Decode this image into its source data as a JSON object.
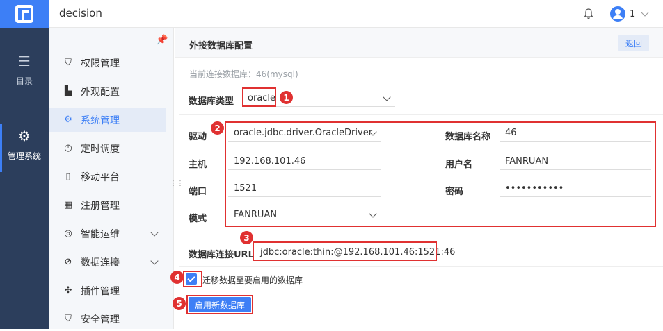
{
  "header": {
    "app_title": "decision",
    "user_name": "1"
  },
  "left_nav": [
    {
      "label": "目录",
      "icon": "list-icon"
    },
    {
      "label": "管理系统",
      "icon": "gear-icon"
    }
  ],
  "sidebar": {
    "items": [
      {
        "label": "权限管理",
        "icon": "shield-icon",
        "expandable": false
      },
      {
        "label": "外观配置",
        "icon": "paint-roller-icon",
        "expandable": false
      },
      {
        "label": "系统管理",
        "icon": "gear-icon",
        "expandable": false,
        "active": true
      },
      {
        "label": "定时调度",
        "icon": "timer-icon",
        "expandable": false
      },
      {
        "label": "移动平台",
        "icon": "mobile-icon",
        "expandable": false
      },
      {
        "label": "注册管理",
        "icon": "register-icon",
        "expandable": false
      },
      {
        "label": "智能运维",
        "icon": "ops-icon",
        "expandable": true
      },
      {
        "label": "数据连接",
        "icon": "link-icon",
        "expandable": true
      },
      {
        "label": "插件管理",
        "icon": "puzzle-icon",
        "expandable": false
      },
      {
        "label": "安全管理",
        "icon": "security-icon",
        "expandable": false
      }
    ]
  },
  "panel": {
    "title": "外接数据库配置",
    "back_label": "返回",
    "current_db_text": "当前连接数据库：46(mysql)",
    "db_type_label": "数据库类型",
    "db_type_value": "oracle",
    "driver_label": "驱动",
    "driver_value": "oracle.jdbc.driver.OracleDriver",
    "host_label": "主机",
    "host_value": "192.168.101.46",
    "port_label": "端口",
    "port_value": "1521",
    "schema_label": "模式",
    "schema_value": "FANRUAN",
    "db_name_label": "数据库名称",
    "db_name_value": "46",
    "username_label": "用户名",
    "username_value": "FANRUAN",
    "password_label": "密码",
    "password_value": "•••••••••••",
    "url_label": "数据库连接URL",
    "url_value": "jdbc:oracle:thin:@192.168.101.46:1521:46",
    "migrate_label": "迁移数据至要启用的数据库",
    "enable_button": "启用新数据库"
  },
  "badges": [
    "1",
    "2",
    "3",
    "4",
    "5"
  ],
  "colors": {
    "accent": "#3d7ff6",
    "nav_bg": "#2c3e5c",
    "annotation_red": "#e03131"
  }
}
